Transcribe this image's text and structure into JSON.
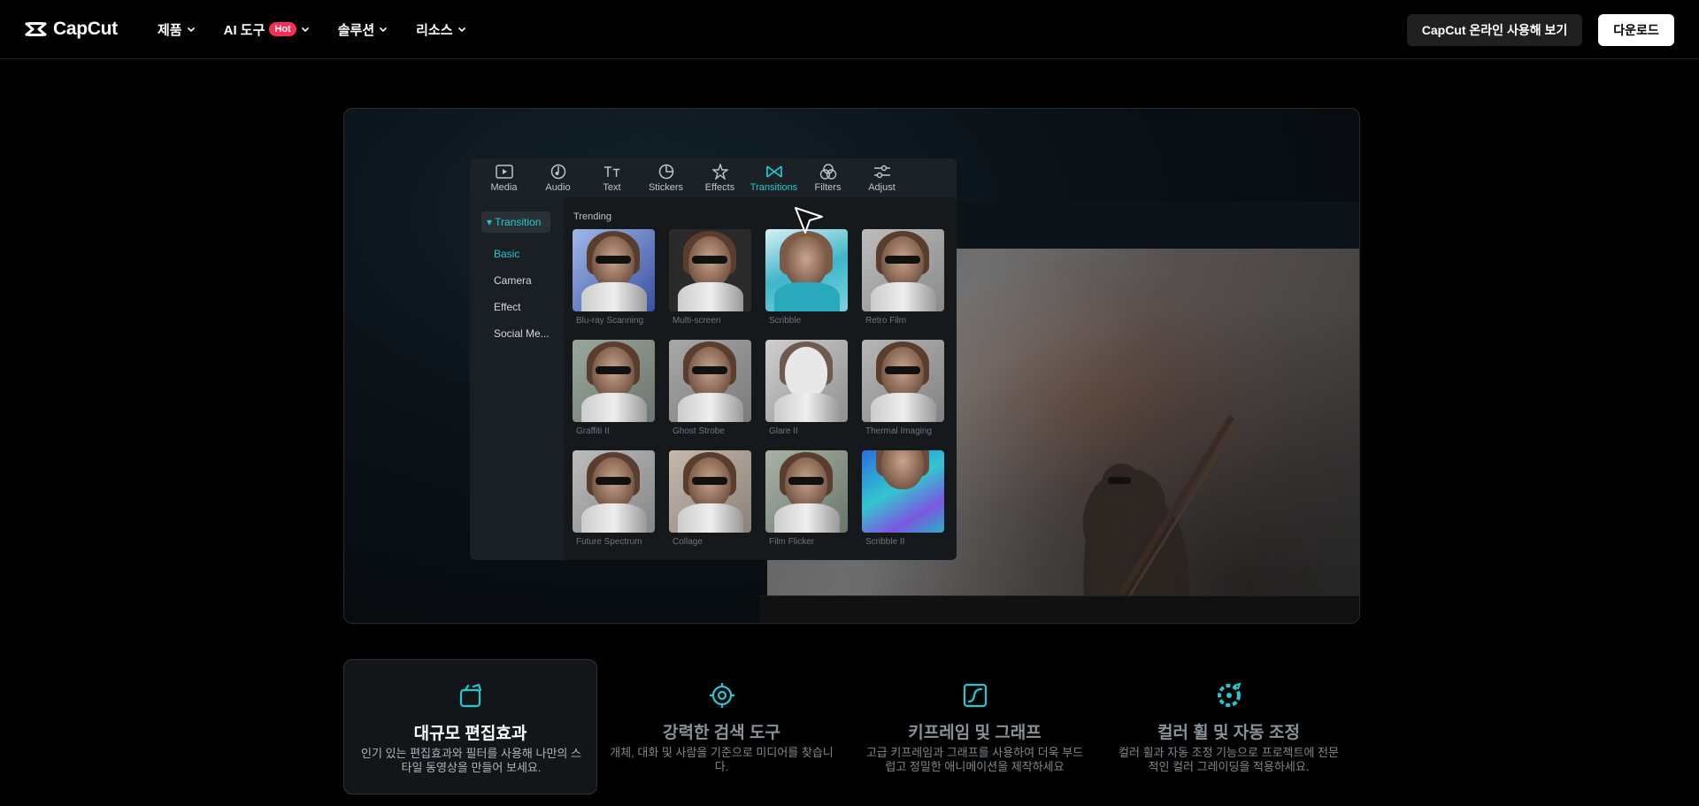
{
  "nav": {
    "logo_text": "CapCut",
    "menu": [
      {
        "label": "제품"
      },
      {
        "label": "AI 도구",
        "badge": "Hot"
      },
      {
        "label": "솔루션"
      },
      {
        "label": "리소스"
      }
    ],
    "online_button": "CapCut 온라인 사용해 보기",
    "download_button": "다운로드"
  },
  "editor": {
    "tabs": [
      {
        "label": "Media",
        "icon": "media-icon"
      },
      {
        "label": "Audio",
        "icon": "audio-icon"
      },
      {
        "label": "Text",
        "icon": "text-icon"
      },
      {
        "label": "Stickers",
        "icon": "stickers-icon"
      },
      {
        "label": "Effects",
        "icon": "effects-icon"
      },
      {
        "label": "Transitions",
        "icon": "transitions-icon",
        "active": true
      },
      {
        "label": "Filters",
        "icon": "filters-icon"
      },
      {
        "label": "Adjust",
        "icon": "adjust-icon"
      }
    ],
    "sidebar_header": "▾ Transition",
    "sidebar_items": [
      "Basic",
      "Camera",
      "Effect",
      "Social Me..."
    ],
    "section_title": "Trending",
    "thumbnails": [
      "Blu-ray Scanning",
      "Multi-screen",
      "Scribble",
      "Retro Film",
      "Graffiti II",
      "Ghost Strobe",
      "Glare II",
      "Thermal Imaging",
      "Future Spectrum",
      "Collage",
      "Film Flicker",
      "Scribble II"
    ]
  },
  "features": [
    {
      "title": "대규모 편집효과",
      "desc": "인기 있는 편집효과와 필터를 사용해 나만의 스타일 동영상을 만들어 보세요.",
      "icon": "edit-effects-icon",
      "active": true
    },
    {
      "title": "강력한 검색 도구",
      "desc": "개체, 대화 및 사람을 기준으로 미디어를 찾습니다.",
      "icon": "search-target-icon"
    },
    {
      "title": "키프레임 및 그래프",
      "desc": "고급 키프레임과 그래프를 사용하여 더욱 부드럽고 정밀한 애니메이션을 제작하세요",
      "icon": "keyframe-graph-icon"
    },
    {
      "title": "컬러 휠 및 자동 조정",
      "desc": "컬러 휠과 자동 조정 기능으로 프로젝트에 전문적인 컬러 그레이딩을 적용하세요.",
      "icon": "color-wheel-icon"
    }
  ],
  "colors": {
    "accent": "#22c8d4",
    "hot": "#fe2c55",
    "background": "#000000"
  }
}
